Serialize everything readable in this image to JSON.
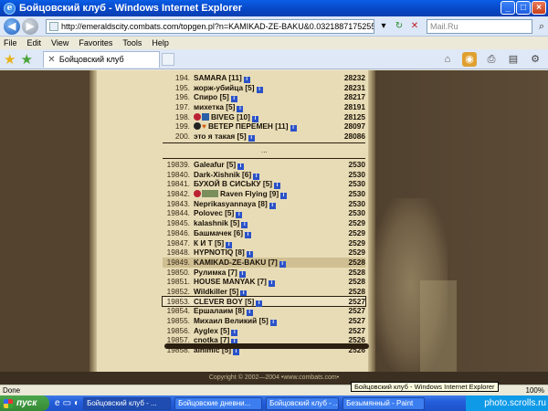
{
  "window": {
    "title": "Бойцовский клуб - Windows Internet Explorer",
    "ie_logo": "e"
  },
  "addressbar": {
    "url": "http://emeraldscity.combats.com/topgen.pl?n=KAMIKAD-ZE-BAKU&0.0321887175255178",
    "search_placeholder": "Mail.Ru"
  },
  "menu": [
    "File",
    "Edit",
    "View",
    "Favorites",
    "Tools",
    "Help"
  ],
  "tab": {
    "label": "Бойцовский клуб"
  },
  "ranking": {
    "top_rows": [
      {
        "rank": "194.",
        "nick": "SAMARA",
        "level": "[11]",
        "score": "28232"
      },
      {
        "rank": "195.",
        "nick": "жорж-убийца",
        "level": "[5]",
        "score": "28231"
      },
      {
        "rank": "196.",
        "nick": "Спиро",
        "level": "[5]",
        "score": "28217"
      },
      {
        "rank": "197.",
        "nick": "михетка",
        "level": "[5]",
        "score": "28191"
      },
      {
        "rank": "198.",
        "nick": "BIVEG",
        "level": "[10]",
        "score": "28125"
      },
      {
        "rank": "199.",
        "nick": "ВЕТЕР ПЕРЕМЕН",
        "level": "[11]",
        "score": "28097"
      },
      {
        "rank": "200.",
        "nick": "это я такая",
        "level": "[5]",
        "score": "28086"
      }
    ],
    "ellipsis": "...",
    "bottom_rows": [
      {
        "rank": "19839.",
        "nick": "Galeafur",
        "level": "[5]",
        "score": "2530"
      },
      {
        "rank": "19840.",
        "nick": "Dark-Xishnik",
        "level": "[6]",
        "score": "2530"
      },
      {
        "rank": "19841.",
        "nick": "БУХОЙ В СИСЬКУ",
        "level": "[5]",
        "score": "2530"
      },
      {
        "rank": "19842.",
        "nick": "Raven Flying",
        "level": "[9]",
        "score": "2530"
      },
      {
        "rank": "19843.",
        "nick": "Neprikasyannaya",
        "level": "[8]",
        "score": "2530"
      },
      {
        "rank": "19844.",
        "nick": "Polovec",
        "level": "[5]",
        "score": "2530"
      },
      {
        "rank": "19845.",
        "nick": "kalashnik",
        "level": "[5]",
        "score": "2529"
      },
      {
        "rank": "19846.",
        "nick": "Башмачек",
        "level": "[6]",
        "score": "2529"
      },
      {
        "rank": "19847.",
        "nick": "К И Т",
        "level": "[5]",
        "score": "2529"
      },
      {
        "rank": "19848.",
        "nick": "HYPNOTIQ",
        "level": "[8]",
        "score": "2529"
      },
      {
        "rank": "19849.",
        "nick": "KAMIKAD-ZE-BAKU",
        "level": "[7]",
        "score": "2528"
      },
      {
        "rank": "19850.",
        "nick": "Рулимка",
        "level": "[7]",
        "score": "2528"
      },
      {
        "rank": "19851.",
        "nick": "HOUSE MANYAK",
        "level": "[7]",
        "score": "2528"
      },
      {
        "rank": "19852.",
        "nick": "Wildkiller",
        "level": "[5]",
        "score": "2528"
      },
      {
        "rank": "19853.",
        "nick": "CLEVER BOY",
        "level": "[5]",
        "score": "2527"
      },
      {
        "rank": "19854.",
        "nick": "Ершалаим",
        "level": "[8]",
        "score": "2527"
      },
      {
        "rank": "19855.",
        "nick": "Михаил Великий",
        "level": "[5]",
        "score": "2527"
      },
      {
        "rank": "19856.",
        "nick": "Ayglex",
        "level": "[5]",
        "score": "2527"
      },
      {
        "rank": "19857.",
        "nick": "cnotka",
        "level": "[7]",
        "score": "2526"
      },
      {
        "rank": "19858.",
        "nick": "alhimic",
        "level": "[5]",
        "score": "2526"
      }
    ],
    "info_glyph": "i",
    "copyright": "Copyright © 2002—2004 •www.combats.com•"
  },
  "status": {
    "left": "Done",
    "tooltip": "Бойцовский клуб - Windows Internet Explorer",
    "zoom": "100%"
  },
  "taskbar": {
    "start": "пуск",
    "items": [
      "Бойцовский клуб - ...",
      "Бойцовские дневни...",
      "Бойцовский клуб - ...",
      "Безымянный - Paint"
    ],
    "tray": "photo.scrolls.ru"
  }
}
